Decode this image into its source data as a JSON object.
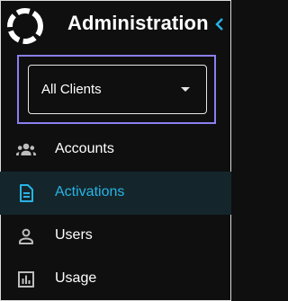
{
  "header": {
    "title": "Administration",
    "logo_icon": "ring-logo-icon",
    "collapse_icon": "chevron-left-icon"
  },
  "client_selector": {
    "value": "All Clients",
    "caret_icon": "caret-down-icon"
  },
  "nav": {
    "items": [
      {
        "label": "Accounts",
        "icon": "people-group-icon",
        "active": false
      },
      {
        "label": "Activations",
        "icon": "document-icon",
        "active": true
      },
      {
        "label": "Users",
        "icon": "person-icon",
        "active": false
      },
      {
        "label": "Usage",
        "icon": "bar-chart-icon",
        "active": false
      }
    ]
  },
  "colors": {
    "background": "#0f0f10",
    "accent": "#28b4e6",
    "active_background": "#14262b",
    "focus_outline": "#8b7ff0",
    "text": "#ffffff",
    "icon": "#bdbdbd"
  }
}
